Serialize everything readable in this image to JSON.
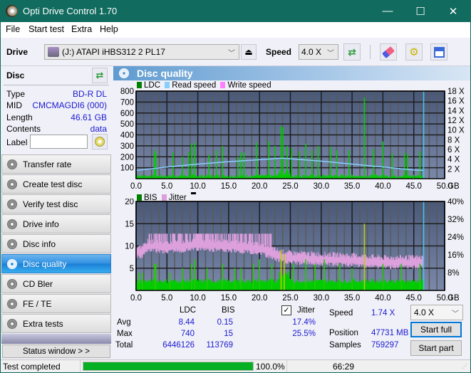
{
  "window": {
    "title": "Opti Drive Control 1.70",
    "minimize": "—",
    "maximize": "☐",
    "close": "✕"
  },
  "menu": [
    "File",
    "Start test",
    "Extra",
    "Help"
  ],
  "toolbar": {
    "drive_label": "Drive",
    "drive_value": "(J:)  ATAPI iHBS312  2 PL17",
    "speed_label": "Speed",
    "speed_value": "4.0 X"
  },
  "disc": {
    "header": "Disc",
    "rows": [
      {
        "k": "Type",
        "v": "BD-R DL"
      },
      {
        "k": "MID",
        "v": "CMCMAGDI6 (000)"
      },
      {
        "k": "Length",
        "v": "46.61 GB"
      },
      {
        "k": "Contents",
        "v": "data"
      }
    ],
    "label_label": "Label",
    "label_value": ""
  },
  "nav": [
    {
      "label": "Transfer rate"
    },
    {
      "label": "Create test disc"
    },
    {
      "label": "Verify test disc"
    },
    {
      "label": "Drive info"
    },
    {
      "label": "Disc info"
    },
    {
      "label": "Disc quality",
      "active": true
    },
    {
      "label": "CD Bler"
    },
    {
      "label": "FE / TE"
    },
    {
      "label": "Extra tests"
    }
  ],
  "status_window_btn": "Status window > >",
  "panel_title": "Disc quality",
  "chart_data": [
    {
      "type": "bar",
      "title": "LDC / Read speed",
      "legend": [
        "LDC",
        "Read speed",
        "Write speed"
      ],
      "legend_colors": [
        "#008000",
        "#87cefa",
        "#ff80ff"
      ],
      "xlabel": "GB",
      "x_ticks": [
        "0.0",
        "5.0",
        "10.0",
        "15.0",
        "20.0",
        "25.0",
        "30.0",
        "35.0",
        "40.0",
        "45.0",
        "50.0"
      ],
      "xlim": [
        0,
        50
      ],
      "y_ticks_left": [
        "100",
        "200",
        "300",
        "400",
        "500",
        "600",
        "700",
        "800"
      ],
      "ylim_left": [
        0,
        800
      ],
      "y_ticks_right": [
        "2 X",
        "4 X",
        "6 X",
        "8 X",
        "10 X",
        "12 X",
        "14 X",
        "16 X",
        "18 X"
      ],
      "ylim_right": [
        0,
        18
      ],
      "ldc_peaks": [
        [
          0.3,
          40
        ],
        [
          3.0,
          260
        ],
        [
          3.2,
          230
        ],
        [
          6.0,
          240
        ],
        [
          7.5,
          200
        ],
        [
          8.5,
          240
        ],
        [
          9.0,
          320
        ],
        [
          9.5,
          330
        ],
        [
          11.8,
          220
        ],
        [
          13.0,
          260
        ],
        [
          14.0,
          300
        ],
        [
          16.5,
          200
        ],
        [
          17.0,
          240
        ],
        [
          17.5,
          240
        ],
        [
          19.5,
          330
        ],
        [
          21.5,
          340
        ],
        [
          22.5,
          300
        ],
        [
          23.5,
          480
        ],
        [
          23.8,
          470
        ],
        [
          24.5,
          300
        ],
        [
          25.2,
          280
        ],
        [
          26.5,
          250
        ],
        [
          27.5,
          320
        ],
        [
          28.5,
          260
        ],
        [
          29.5,
          300
        ],
        [
          31.5,
          290
        ],
        [
          32.5,
          260
        ],
        [
          34.5,
          260
        ],
        [
          37.0,
          740
        ],
        [
          38.5,
          270
        ],
        [
          40.0,
          340
        ],
        [
          41.5,
          230
        ],
        [
          43.5,
          240
        ],
        [
          44.0,
          220
        ],
        [
          46.0,
          250
        ]
      ],
      "ldc_baseline": 25,
      "read_speed": [
        [
          0,
          1.7
        ],
        [
          5,
          2.4
        ],
        [
          10,
          3.0
        ],
        [
          15,
          3.5
        ],
        [
          20,
          3.9
        ],
        [
          23.5,
          4.2
        ],
        [
          25,
          4.1
        ],
        [
          30,
          3.6
        ],
        [
          35,
          3.0
        ],
        [
          40,
          2.4
        ],
        [
          45,
          1.8
        ],
        [
          46.6,
          1.7
        ]
      ],
      "end_marker_gb": 46.6
    },
    {
      "type": "bar",
      "title": "BIS / Jitter",
      "legend": [
        "BIS",
        "Jitter"
      ],
      "legend_colors": [
        "#008000",
        "#dda0dd"
      ],
      "xlabel": "GB",
      "x_ticks": [
        "0.0",
        "5.0",
        "10.0",
        "15.0",
        "20.0",
        "25.0",
        "30.0",
        "35.0",
        "40.0",
        "45.0",
        "50.0"
      ],
      "xlim": [
        0,
        50
      ],
      "y_ticks_left": [
        "5",
        "10",
        "15",
        "20"
      ],
      "ylim_left": [
        0,
        20
      ],
      "y_ticks_right": [
        "8%",
        "16%",
        "24%",
        "32%",
        "40%"
      ],
      "ylim_right": [
        0,
        40
      ],
      "bis_peaks": [
        [
          0.5,
          4
        ],
        [
          1.0,
          4
        ],
        [
          3.0,
          6
        ],
        [
          3.2,
          6
        ],
        [
          5.5,
          4
        ],
        [
          7.5,
          5
        ],
        [
          9.0,
          6
        ],
        [
          9.5,
          7
        ],
        [
          11.5,
          5
        ],
        [
          14.0,
          6
        ],
        [
          16.0,
          5
        ],
        [
          17.0,
          5
        ],
        [
          19.0,
          6
        ],
        [
          20.0,
          7
        ],
        [
          22.0,
          6
        ],
        [
          23.5,
          9
        ],
        [
          24.0,
          8
        ],
        [
          25.5,
          6
        ],
        [
          27.5,
          7
        ],
        [
          29.0,
          6
        ],
        [
          30.5,
          7
        ],
        [
          33.0,
          6
        ],
        [
          35.0,
          5
        ],
        [
          37.0,
          15
        ],
        [
          40.0,
          6
        ],
        [
          43.0,
          6
        ],
        [
          46.0,
          6
        ]
      ],
      "bis_baseline": 2,
      "jitter_pct": [
        [
          0,
          18
        ],
        [
          1,
          18.5
        ],
        [
          2,
          21
        ],
        [
          5,
          20.5
        ],
        [
          10,
          21.5
        ],
        [
          15,
          21
        ],
        [
          20,
          20
        ],
        [
          23,
          16.5
        ],
        [
          25,
          15.5
        ],
        [
          30,
          15
        ],
        [
          35,
          14.5
        ],
        [
          40,
          13.5
        ],
        [
          46.6,
          13.5
        ]
      ],
      "jitter_band_top_pct": 25.5,
      "end_marker_gb": 46.6
    }
  ],
  "stats": {
    "col_ldc": "LDC",
    "col_bis": "BIS",
    "jitter_label": "Jitter",
    "jitter_checked": true,
    "rows": [
      {
        "k": "Avg",
        "ldc": "8.44",
        "bis": "0.15",
        "jit": "17.4%"
      },
      {
        "k": "Max",
        "ldc": "740",
        "bis": "15",
        "jit": "25.5%"
      },
      {
        "k": "Total",
        "ldc": "6446126",
        "bis": "113769",
        "jit": ""
      }
    ],
    "speed_label": "Speed",
    "speed_value": "1.74 X",
    "position_label": "Position",
    "position_value": "47731 MB",
    "samples_label": "Samples",
    "samples_value": "759297",
    "speed_select": "4.0 X",
    "start_full": "Start full",
    "start_part": "Start part"
  },
  "status": {
    "text": "Test completed",
    "progress_pct": 100,
    "progress_text": "100.0%",
    "time": "66:29"
  }
}
